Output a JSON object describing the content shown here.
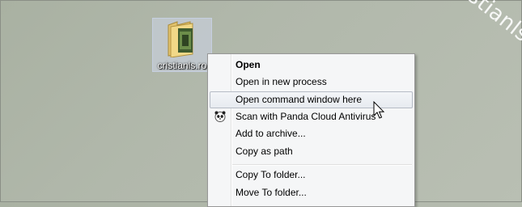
{
  "desktop": {
    "watermark_text": "cristianls.ro",
    "icon_label": "cristianls.ro"
  },
  "context_menu": {
    "items": [
      {
        "label": "Open",
        "bold": true
      },
      {
        "label": "Open in new process"
      },
      {
        "label": "Open command window here",
        "hovered": true
      },
      {
        "label": "Scan with Panda Cloud Antivirus",
        "icon": "panda-icon"
      },
      {
        "label": "Add to archive..."
      },
      {
        "label": "Copy as path"
      },
      {
        "label": "Copy To folder..."
      },
      {
        "label": "Move To folder..."
      }
    ]
  },
  "colors": {
    "desktop_bg": "#b1b8ab",
    "menu_bg": "#f5f6f7",
    "hover_border": "#b6bcc6"
  }
}
